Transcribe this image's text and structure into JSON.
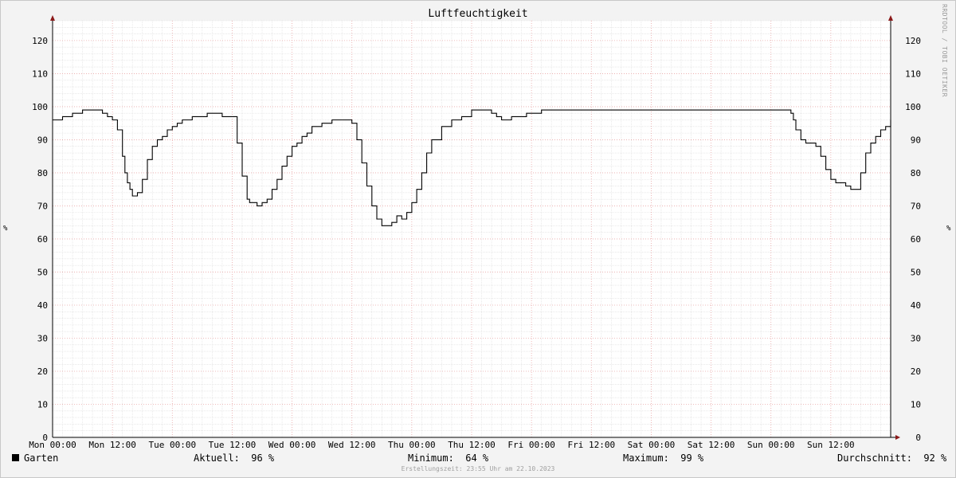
{
  "title": "Luftfeuchtigkeit",
  "watermark": "RRDTOOL / TOBI OETIKER",
  "y_unit": "%",
  "legend": {
    "series_name": "Garten",
    "current_label": "Aktuell:",
    "current_value": "96 %",
    "min_label": "Minimum:",
    "min_value": "64 %",
    "max_label": "Maximum:",
    "max_value": "99 %",
    "avg_label": "Durchschnitt:",
    "avg_value": "92 %"
  },
  "footer": "Erstellungszeit: 23:55 Uhr am 22.10.2023",
  "colors": {
    "line": "#000000",
    "major_grid": "#e9a8a8",
    "minor_grid": "#dcdcdc",
    "axis": "#000000",
    "arrow": "#8b1a1a",
    "background": "#f3f3f3",
    "plot": "#ffffff"
  },
  "chart_data": {
    "type": "line",
    "title": "Luftfeuchtigkeit",
    "xlabel": "",
    "ylabel": "%",
    "ylim": [
      0,
      126
    ],
    "xlim_hours": [
      0,
      168
    ],
    "x_tick_labels": [
      "Mon 00:00",
      "Mon 12:00",
      "Tue 00:00",
      "Tue 12:00",
      "Wed 00:00",
      "Wed 12:00",
      "Thu 00:00",
      "Thu 12:00",
      "Fri 00:00",
      "Fri 12:00",
      "Sat 00:00",
      "Sat 12:00",
      "Sun 00:00",
      "Sun 12:00"
    ],
    "y_ticks": [
      0,
      10,
      20,
      30,
      40,
      50,
      60,
      70,
      80,
      90,
      100,
      110,
      120
    ],
    "grid": true,
    "series": [
      {
        "name": "Garten",
        "x_hours": [
          0,
          2,
          4,
          6,
          7,
          9,
          10,
          11,
          12,
          13,
          14,
          14.5,
          15,
          15.5,
          16,
          16.5,
          17,
          18,
          19,
          20,
          21,
          22,
          23,
          24,
          25,
          26,
          27,
          28,
          29,
          30,
          31,
          32,
          34,
          36,
          37,
          38,
          39,
          39.5,
          40,
          41,
          42,
          43,
          44,
          45,
          46,
          47,
          48,
          49,
          50,
          51,
          52,
          54,
          56,
          57,
          58,
          59,
          60,
          61,
          62,
          63,
          64,
          65,
          66,
          67,
          68,
          69,
          70,
          71,
          72,
          73,
          74,
          75,
          76,
          78,
          80,
          82,
          84,
          86,
          87,
          88,
          89,
          90,
          92,
          93,
          94,
          95,
          96,
          98,
          100,
          102,
          104,
          106,
          108,
          110,
          112,
          114,
          116,
          118,
          120,
          122,
          124,
          126,
          128,
          130,
          132,
          134,
          136,
          138,
          140,
          142,
          144,
          147,
          148,
          148.5,
          149,
          150,
          151,
          152,
          153,
          154,
          155,
          156,
          157,
          158,
          159,
          160,
          161,
          162,
          163,
          164,
          165,
          166,
          167,
          168
        ],
        "values": [
          96,
          97,
          98,
          99,
          99,
          99,
          98,
          97,
          96,
          93,
          85,
          80,
          77,
          75,
          73,
          73,
          74,
          78,
          84,
          88,
          90,
          91,
          93,
          94,
          95,
          96,
          96,
          97,
          97,
          97,
          98,
          98,
          97,
          97,
          89,
          79,
          72,
          71,
          71,
          70,
          71,
          72,
          75,
          78,
          82,
          85,
          88,
          89,
          91,
          92,
          94,
          95,
          96,
          96,
          96,
          96,
          95,
          90,
          83,
          76,
          70,
          66,
          64,
          64,
          65,
          67,
          66,
          68,
          71,
          75,
          80,
          86,
          90,
          94,
          96,
          97,
          99,
          99,
          99,
          98,
          97,
          96,
          97,
          97,
          97,
          98,
          98,
          99,
          99,
          99,
          99,
          99,
          99,
          99,
          99,
          99,
          99,
          99,
          99,
          99,
          99,
          99,
          99,
          99,
          99,
          99,
          99,
          99,
          99,
          99,
          99,
          99,
          98,
          96,
          93,
          90,
          89,
          89,
          88,
          85,
          81,
          78,
          77,
          77,
          76,
          75,
          75,
          80,
          86,
          89,
          91,
          93,
          94,
          96,
          96,
          96
        ]
      }
    ]
  }
}
